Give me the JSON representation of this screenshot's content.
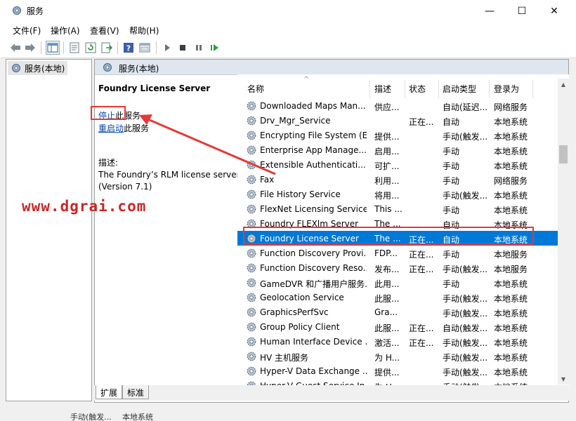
{
  "window": {
    "title": "服务",
    "controls": {
      "minimize": "—",
      "maximize": "☐",
      "close": "✕"
    }
  },
  "menu": [
    "文件(F)",
    "操作(A)",
    "查看(V)",
    "帮助(H)"
  ],
  "tree": {
    "root_label": "服务(本地)"
  },
  "pane_header": "服务(本地)",
  "detail": {
    "service_name": "Foundry License Server",
    "stop_link": "停止",
    "stop_suffix": "此服务",
    "restart_link": "重启动",
    "restart_suffix": "此服务",
    "desc_label": "描述:",
    "desc_text": "The Foundry’s RLM license server (Version 7.1)"
  },
  "columns": [
    "名称",
    "描述",
    "状态",
    "启动类型",
    "登录为"
  ],
  "services": [
    {
      "name": "Downloaded Maps Man...",
      "desc": "供应...",
      "status": "",
      "startup": "自动(延迟...",
      "logon": "网络服务"
    },
    {
      "name": "Drv_Mgr_Service",
      "desc": "",
      "status": "正在...",
      "startup": "自动",
      "logon": "本地系统"
    },
    {
      "name": "Encrypting File System (E...",
      "desc": "提供...",
      "status": "",
      "startup": "手动(触发...",
      "logon": "本地系统"
    },
    {
      "name": "Enterprise App Manage...",
      "desc": "启用...",
      "status": "",
      "startup": "手动",
      "logon": "本地系统"
    },
    {
      "name": "Extensible Authenticati...",
      "desc": "可扩...",
      "status": "",
      "startup": "手动",
      "logon": "本地系统"
    },
    {
      "name": "Fax",
      "desc": "利用...",
      "status": "",
      "startup": "手动",
      "logon": "网络服务"
    },
    {
      "name": "File History Service",
      "desc": "将用...",
      "status": "",
      "startup": "手动(触发...",
      "logon": "本地系统"
    },
    {
      "name": "FlexNet Licensing Service",
      "desc": "This ...",
      "status": "",
      "startup": "手动",
      "logon": "本地系统"
    },
    {
      "name": "Foundry FLEXlm Server",
      "desc": "The ...",
      "status": "",
      "startup": "自动",
      "logon": "本地系统"
    },
    {
      "name": "Foundry License Server",
      "desc": "The ...",
      "status": "正在...",
      "startup": "自动",
      "logon": "本地系统"
    },
    {
      "name": "Function Discovery Provi...",
      "desc": "FDP...",
      "status": "正在...",
      "startup": "手动",
      "logon": "本地服务"
    },
    {
      "name": "Function Discovery Reso...",
      "desc": "发布...",
      "status": "正在...",
      "startup": "手动(触发...",
      "logon": "本地服务"
    },
    {
      "name": "GameDVR 和广播用户服务...",
      "desc": "此用...",
      "status": "",
      "startup": "手动",
      "logon": "本地系统"
    },
    {
      "name": "Geolocation Service",
      "desc": "此服...",
      "status": "",
      "startup": "手动(触发...",
      "logon": "本地系统"
    },
    {
      "name": "GraphicsPerfSvc",
      "desc": "Gra...",
      "status": "",
      "startup": "手动(触发...",
      "logon": "本地系统"
    },
    {
      "name": "Group Policy Client",
      "desc": "此服...",
      "status": "正在...",
      "startup": "自动(触发...",
      "logon": "本地系统"
    },
    {
      "name": "Human Interface Device ...",
      "desc": "激活...",
      "status": "正在...",
      "startup": "手动(触发...",
      "logon": "本地系统"
    },
    {
      "name": "HV 主机服务",
      "desc": "为 H...",
      "status": "",
      "startup": "手动(触发...",
      "logon": "本地系统"
    },
    {
      "name": "Hyper-V Data Exchange ...",
      "desc": "提供...",
      "status": "",
      "startup": "手动(触发...",
      "logon": "本地系统"
    },
    {
      "name": "Hyper-V Guest Service In...",
      "desc": "为 H...",
      "status": "",
      "startup": "手动(触发...",
      "logon": "本地系统"
    }
  ],
  "selected_index": 9,
  "tabs": [
    "扩展",
    "标准"
  ],
  "statusbar": {
    "startup": "手动(触发...",
    "logon": "本地系统"
  },
  "watermark": "www.dgrai.com",
  "accent_colors": {
    "selection": "#0078d7",
    "annotation": "#e53935",
    "link": "#0645ad"
  }
}
